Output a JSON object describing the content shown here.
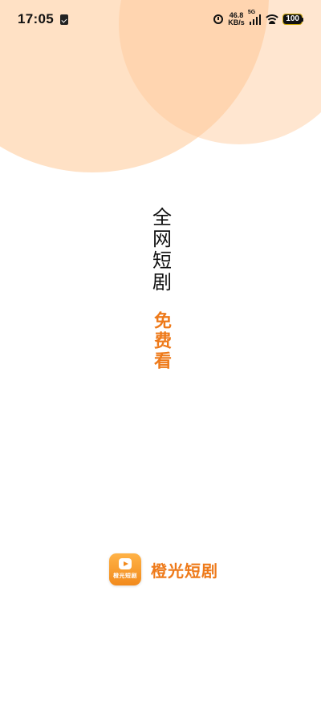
{
  "status_bar": {
    "time": "17:05",
    "net_speed_value": "46.8",
    "net_speed_unit": "KB/s",
    "network_type": "5G",
    "battery": "100",
    "icons": [
      "clipboard-check-icon",
      "alarm-icon",
      "signal-icon",
      "wifi-icon",
      "battery-icon"
    ]
  },
  "splash": {
    "slogan_line_1": "全网短剧",
    "slogan_line_2": "免费看"
  },
  "brand": {
    "app_icon_label": "橙光短剧",
    "app_name": "橙光短剧"
  },
  "colors": {
    "accent": "#ee7a1a",
    "circle": "#ffc896",
    "text_primary": "#111111",
    "background": "#ffffff"
  }
}
